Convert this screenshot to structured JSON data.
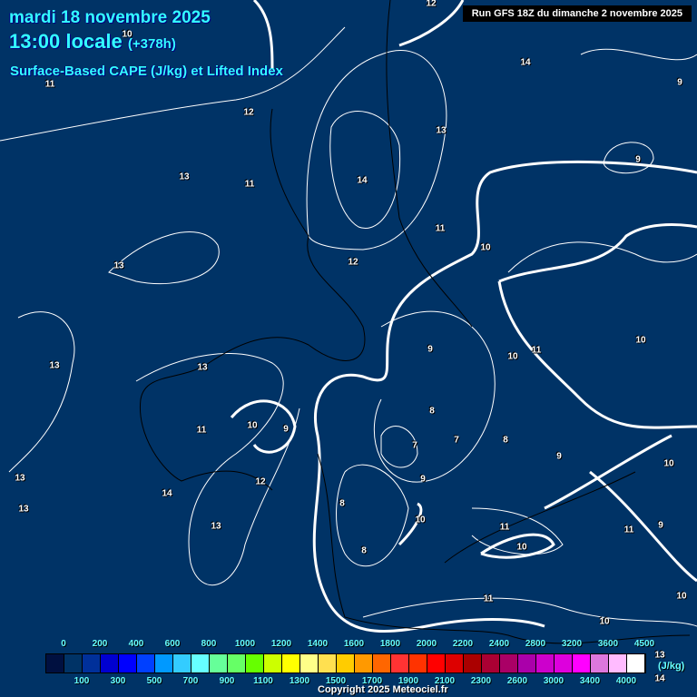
{
  "header": {
    "date": "mardi 18 novembre 2025",
    "time": "13:00 locale",
    "offset": "(+378h)",
    "product": "Surface-Based CAPE (J/kg) et Lifted Index",
    "run": "Run GFS 18Z du dimanche 2 novembre 2025"
  },
  "contour_labels": [
    "12",
    "10",
    "14",
    "11",
    "12",
    "13",
    "11",
    "13",
    "13",
    "14",
    "11",
    "10",
    "12",
    "9",
    "9",
    "13",
    "13",
    "9",
    "10",
    "11",
    "10",
    "13",
    "11",
    "10",
    "9",
    "8",
    "7",
    "7",
    "8",
    "9",
    "14",
    "12",
    "13",
    "13",
    "9",
    "8",
    "10",
    "11",
    "10",
    "11",
    "9",
    "10",
    "8",
    "11",
    "10",
    "10",
    "13",
    "14"
  ],
  "legend": {
    "unit": "(J/kg)",
    "top_labels": [
      "0",
      "200",
      "400",
      "600",
      "800",
      "1000",
      "1200",
      "1400",
      "1600",
      "1800",
      "2000",
      "2200",
      "2400",
      "2800",
      "3200",
      "3600",
      "4500"
    ],
    "bottom_labels": [
      "100",
      "300",
      "500",
      "700",
      "900",
      "1100",
      "1300",
      "1500",
      "1700",
      "1900",
      "2100",
      "2300",
      "2600",
      "3000",
      "3400",
      "4000"
    ],
    "colors": [
      "#001040",
      "#003366",
      "#00309a",
      "#0000d0",
      "#0000ff",
      "#0040ff",
      "#0099ff",
      "#33ccff",
      "#66ffff",
      "#66ff99",
      "#66ff66",
      "#66ff00",
      "#ccff00",
      "#ffff00",
      "#ffff88",
      "#ffe050",
      "#ffcc00",
      "#ff9900",
      "#ff6600",
      "#ff3333",
      "#ff3300",
      "#ff0000",
      "#dd0000",
      "#aa0000",
      "#aa0033",
      "#aa0066",
      "#aa00aa",
      "#cc00cc",
      "#dd00dd",
      "#ff00ff",
      "#dd77dd",
      "#ffbbff",
      "#ffffff"
    ]
  },
  "copyright": "Copyright 2025 Meteociel.fr"
}
